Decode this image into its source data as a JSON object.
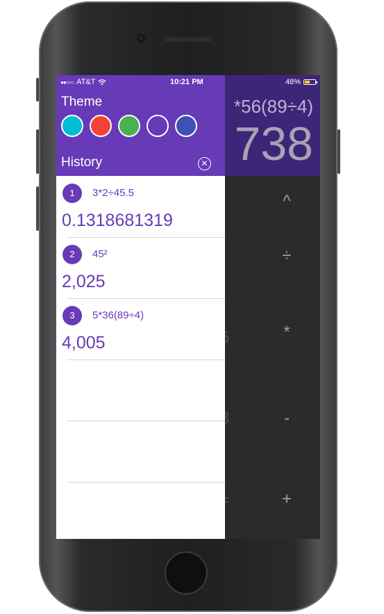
{
  "status_bar": {
    "signal": "●●○○○",
    "carrier": "AT&T",
    "wifi_icon": "wifi-icon",
    "time": "10:21 PM",
    "battery": "48%",
    "battery_level": 0.48
  },
  "calculator": {
    "expression": "*56(89÷4)",
    "result": "738",
    "keys": [
      "^",
      "÷",
      "*",
      "-",
      "+"
    ],
    "ghost_keys": [
      ")",
      "6",
      "3",
      "="
    ]
  },
  "drawer": {
    "theme_label": "Theme",
    "theme_colors": [
      "#00bcd4",
      "#f44336",
      "#4caf50",
      "#673ab7",
      "#3f51b5"
    ],
    "history_label": "History",
    "clear_icon": "close-circle-icon",
    "history": [
      {
        "index": "1",
        "expression": "3*2÷45.5",
        "result": "0.1318681319"
      },
      {
        "index": "2",
        "expression": "45²",
        "result": "2,025"
      },
      {
        "index": "3",
        "expression": "5*36(89÷4)",
        "result": "4,005"
      }
    ]
  },
  "colors": {
    "accent": "#673ab7",
    "calc_header": "#3d2577",
    "calc_body": "#2b2b2d"
  }
}
